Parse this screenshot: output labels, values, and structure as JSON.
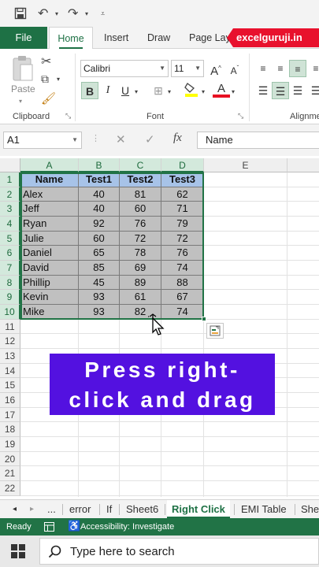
{
  "qat": {
    "icons": [
      "save-icon",
      "undo-icon",
      "redo-icon",
      "customize-icon"
    ]
  },
  "ribbon": {
    "file_label": "File",
    "tabs": [
      "Home",
      "Insert",
      "Draw",
      "Page Lay"
    ],
    "brand": "excelguruji.in",
    "clipboard": {
      "paste": "Paste",
      "label": "Clipboard"
    },
    "font": {
      "name": "Calibri",
      "size": "11",
      "label": "Font"
    },
    "alignment": {
      "label": "Alignme"
    },
    "colors": {
      "accent": "#217346",
      "fill": "#ffff00",
      "fontcolor": "#e81123",
      "brand": "#e8112d"
    }
  },
  "formula_bar": {
    "cell_ref": "A1",
    "content": "Name",
    "fx": "fx"
  },
  "sheet": {
    "columns": [
      "A",
      "B",
      "C",
      "D",
      "E"
    ],
    "rows": [
      "1",
      "2",
      "3",
      "4",
      "5",
      "6",
      "7",
      "8",
      "9",
      "10",
      "11",
      "12",
      "13",
      "14",
      "15",
      "16",
      "17",
      "18",
      "19",
      "20",
      "21",
      "22"
    ],
    "header": [
      "Name",
      "Test1",
      "Test2",
      "Test3"
    ],
    "data": [
      [
        "Alex",
        "40",
        "81",
        "62"
      ],
      [
        "Jeff",
        "40",
        "60",
        "71"
      ],
      [
        "Ryan",
        "92",
        "76",
        "79"
      ],
      [
        "Julie",
        "60",
        "72",
        "72"
      ],
      [
        "Daniel",
        "65",
        "78",
        "76"
      ],
      [
        "David",
        "85",
        "69",
        "74"
      ],
      [
        "Phillip",
        "45",
        "89",
        "88"
      ],
      [
        "Kevin",
        "93",
        "61",
        "67"
      ],
      [
        "Mike",
        "93",
        "82",
        "74"
      ]
    ],
    "header_fill": "#a7c3e8",
    "data_fill": "#c0c0c0"
  },
  "callout": {
    "line1": "Press right-",
    "line2": "click and drag",
    "bg": "#5311e0"
  },
  "sheet_tabs": {
    "more": "...",
    "tabs": [
      "error",
      "If",
      "Sheet6",
      "Right Click",
      "EMI Table",
      "She"
    ],
    "active": "Right Click"
  },
  "status": {
    "ready": "Ready",
    "accessibility": "Accessibility: Investigate"
  },
  "taskbar": {
    "search_placeholder": "Type here to search"
  }
}
